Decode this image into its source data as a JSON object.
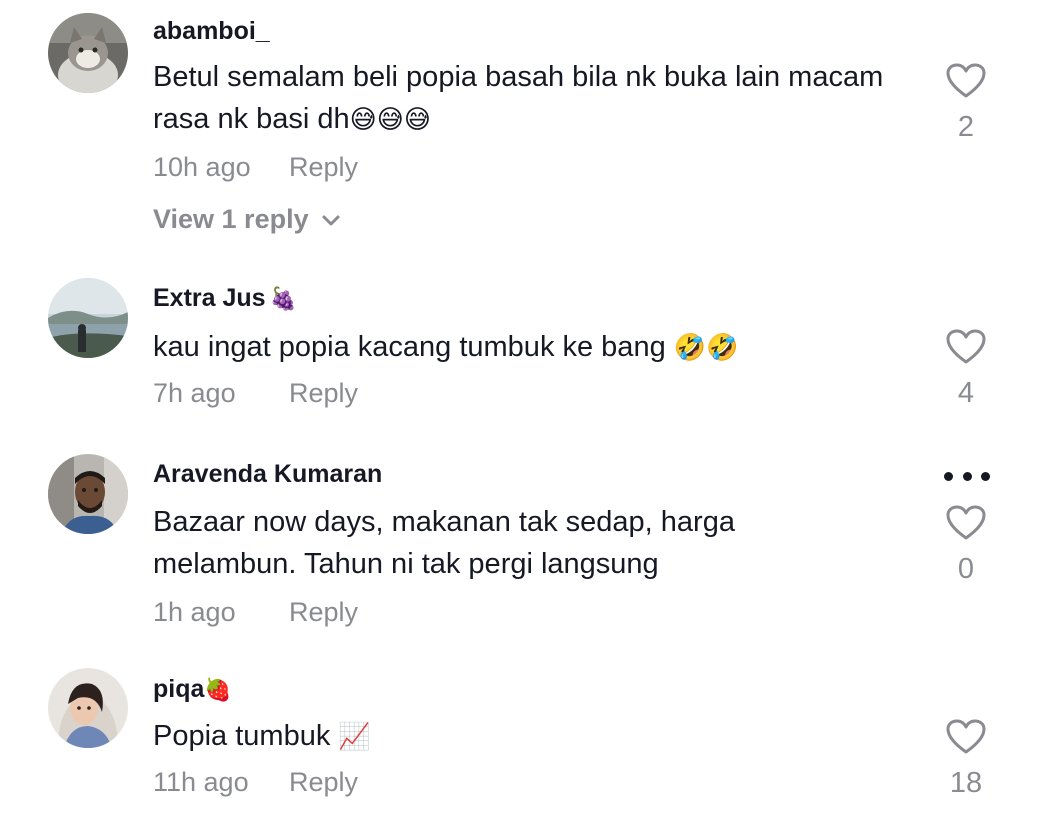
{
  "comments": [
    {
      "username": "abamboi_",
      "badge": "",
      "text": "Betul semalam beli popia basah bila nk buka lain macam rasa nk basi dh",
      "emoji": "😅😅😅",
      "time": "10h ago",
      "reply_label": "Reply",
      "likes": "2",
      "view_replies": "View 1 reply"
    },
    {
      "username": "Extra Jus",
      "badge": "🍇",
      "text": "kau ingat popia kacang tumbuk ke bang ",
      "emoji": "🤣🤣",
      "time": "7h ago",
      "reply_label": "Reply",
      "likes": "4"
    },
    {
      "username": "Aravenda Kumaran",
      "badge": "",
      "text": "Bazaar now days, makanan tak sedap, harga melambun. Tahun ni tak pergi langsung",
      "emoji": "",
      "time": "1h ago",
      "reply_label": "Reply",
      "likes": "0"
    },
    {
      "username": "piqa",
      "badge": "🍓",
      "text": "Popia tumbuk ",
      "emoji": "📈",
      "time": "11h ago",
      "reply_label": "Reply",
      "likes": "18"
    }
  ],
  "icons": {
    "heart": "heart-outline-icon",
    "more": "more-horizontal-icon",
    "chevron": "chevron-down-icon"
  },
  "colors": {
    "text_primary": "#161823",
    "text_secondary": "#8a8b91"
  }
}
